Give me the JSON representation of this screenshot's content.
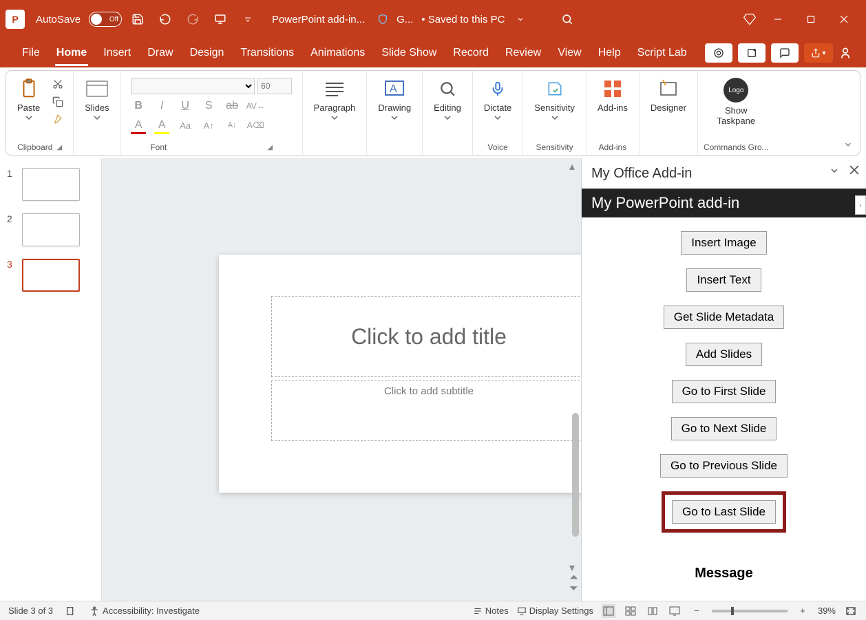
{
  "titlebar": {
    "autosave_label": "AutoSave",
    "autosave_state": "Off",
    "doc_name": "PowerPoint add-in...",
    "sensitivity_short": "G...",
    "save_status": "• Saved to this PC"
  },
  "menu": {
    "tabs": [
      "File",
      "Home",
      "Insert",
      "Draw",
      "Design",
      "Transitions",
      "Animations",
      "Slide Show",
      "Record",
      "Review",
      "View",
      "Help",
      "Script Lab"
    ],
    "active": "Home"
  },
  "ribbon": {
    "clipboard": {
      "paste": "Paste",
      "label": "Clipboard"
    },
    "slides": {
      "btn": "Slides"
    },
    "font": {
      "size_placeholder": "60",
      "label": "Font"
    },
    "paragraph": {
      "btn": "Paragraph"
    },
    "drawing": {
      "btn": "Drawing"
    },
    "editing": {
      "btn": "Editing"
    },
    "dictate": {
      "btn": "Dictate",
      "label": "Voice"
    },
    "sensitivity": {
      "btn": "Sensitivity",
      "label": "Sensitivity"
    },
    "addins": {
      "btn": "Add-ins",
      "label": "Add-ins"
    },
    "designer": {
      "btn": "Designer"
    },
    "taskpane": {
      "btn_l1": "Show",
      "btn_l2": "Taskpane",
      "label": "Commands Gro..."
    }
  },
  "thumbs": {
    "items": [
      {
        "n": "1"
      },
      {
        "n": "2"
      },
      {
        "n": "3"
      }
    ],
    "selected": 3
  },
  "slide": {
    "title_placeholder": "Click to add title",
    "subtitle_placeholder": "Click to add subtitle"
  },
  "taskpane": {
    "header": "My Office Add-in",
    "title": "My PowerPoint add-in",
    "buttons": [
      "Insert Image",
      "Insert Text",
      "Get Slide Metadata",
      "Add Slides",
      "Go to First Slide",
      "Go to Next Slide",
      "Go to Previous Slide",
      "Go to Last Slide"
    ],
    "highlighted_index": 7,
    "message_label": "Message"
  },
  "statusbar": {
    "slide_pos": "Slide 3 of 3",
    "accessibility": "Accessibility: Investigate",
    "notes": "Notes",
    "display": "Display Settings",
    "zoom": "39%"
  }
}
